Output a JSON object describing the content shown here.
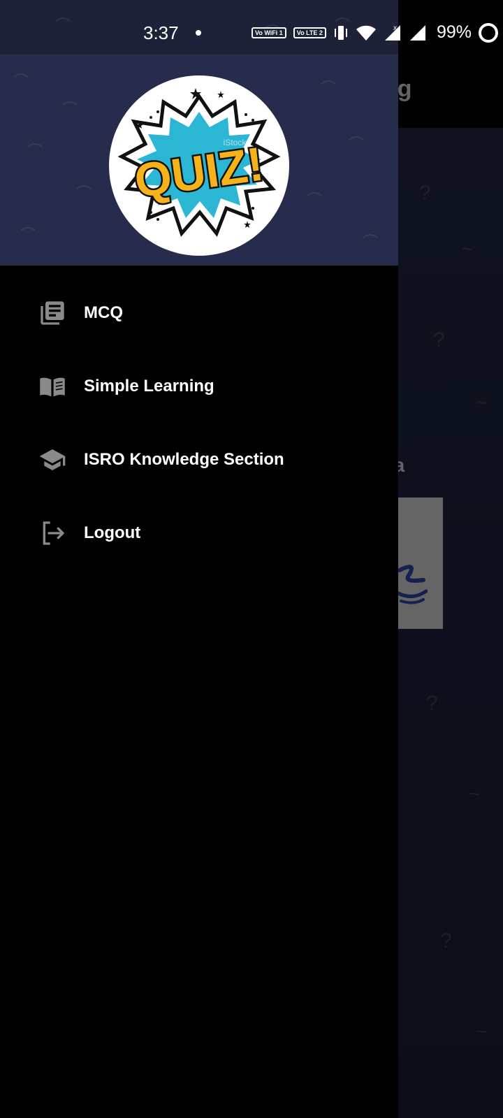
{
  "status_bar": {
    "time": "3:37",
    "vowifi_label": "Vo WiFi 1",
    "volte_label": "Vo LTE 2",
    "battery_percent": "99%"
  },
  "background_app": {
    "appbar_title_fragment": "ng",
    "label_fragment": "va"
  },
  "drawer": {
    "logo_text": "QUIZ!",
    "logo_watermark": "iStock",
    "menu_items": [
      {
        "label": "MCQ",
        "icon": "newspaper-icon"
      },
      {
        "label": "Simple Learning",
        "icon": "book-open-icon"
      },
      {
        "label": "ISRO Knowledge Section",
        "icon": "graduation-cap-icon"
      },
      {
        "label": "Logout",
        "icon": "logout-icon"
      }
    ]
  },
  "colors": {
    "drawer_bg": "#000000",
    "header_bg": "#272c4c",
    "logo_yellow": "#f6b21b",
    "logo_cyan": "#2bb7d3",
    "icon_gray": "#8a8a8a"
  }
}
